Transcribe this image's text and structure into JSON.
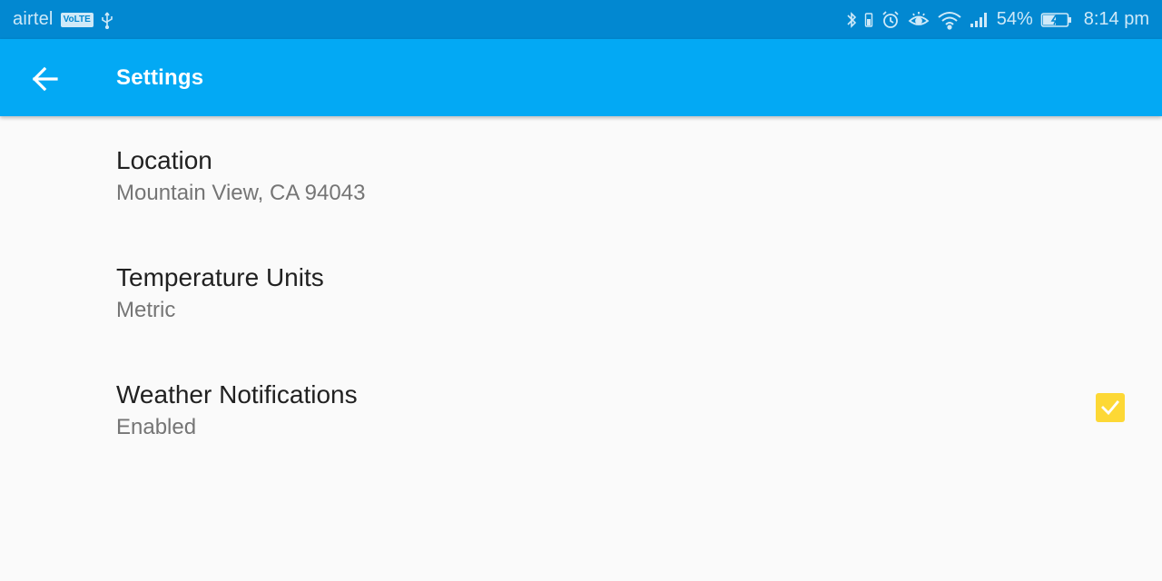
{
  "status_bar": {
    "carrier": "airtel",
    "network_badge": "VoLTE",
    "icons_left": [
      "usb-icon"
    ],
    "icons_right": [
      "bluetooth-icon",
      "battery-vibrate-icon",
      "alarm-icon",
      "eye-comfort-icon",
      "wifi-icon",
      "signal-icon"
    ],
    "battery_percent": "54%",
    "battery_level": 0.54,
    "charging": true,
    "time": "8:14 pm"
  },
  "app_bar": {
    "title": "Settings",
    "back_icon": "arrow-back-icon"
  },
  "preferences": [
    {
      "title": "Location",
      "summary": "Mountain View, CA 94043"
    },
    {
      "title": "Temperature Units",
      "summary": "Metric"
    },
    {
      "title": "Weather Notifications",
      "summary": "Enabled",
      "checkbox": true,
      "checked": true
    }
  ],
  "colors": {
    "status_bar": "#0288d1",
    "app_bar": "#03a9f4",
    "checkbox_accent": "#fdd835",
    "background": "#fafafa"
  }
}
